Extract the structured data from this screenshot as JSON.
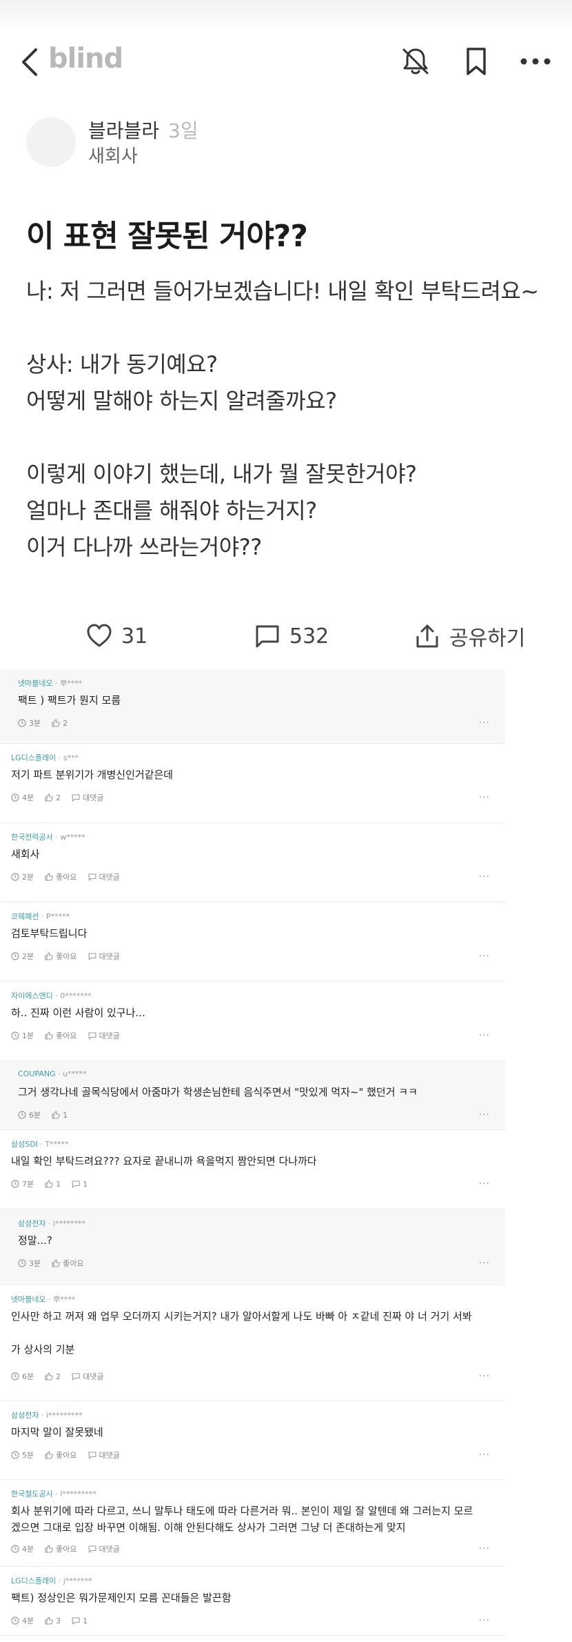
{
  "nav": {
    "logo": "blind",
    "back_icon": "chevron-left-icon",
    "bell_icon": "bell-off-icon",
    "bookmark_icon": "bookmark-icon",
    "more_icon": "more-horizontal-icon"
  },
  "post": {
    "author_name": "블라블라",
    "time": "3일",
    "company": "새회사",
    "title": "이 표현 잘못된 거야??",
    "body": "나: 저 그러면 들어가보겠습니다! 내일 확인 부탁드려요~\n\n상사: 내가 동기예요?\n어떻게 말해야 하는지 알려줄까요?\n\n이렇게 이야기 했는데, 내가 뭘 잘못한거야?\n얼마나 존대를 해줘야 하는거지?\n이거 다나까 쓰라는거야??"
  },
  "actions": {
    "likes": "31",
    "comments": "532",
    "share_label": "공유하기"
  },
  "comments": [
    {
      "company": "넷마블네오",
      "user": "뿌****",
      "text": "팩트 ) 팩트가 뭔지 모름",
      "time": "3분",
      "likes": "2",
      "reply": "",
      "highlight": true
    },
    {
      "company": "LG디스플레이",
      "user": "s***",
      "text": "저기 파트 분위기가 개병신인거같은데",
      "time": "4분",
      "likes": "2",
      "reply": "대댓글",
      "highlight": false
    },
    {
      "company": "한국전력공사",
      "user": "w*****",
      "text": "새회사",
      "time": "2분",
      "likes": "좋아요",
      "reply": "대댓글",
      "highlight": false
    },
    {
      "company": "코웨패션",
      "user": "P*****",
      "text": "검토부탁드립니다",
      "time": "2분",
      "likes": "좋아요",
      "reply": "대댓글",
      "highlight": false
    },
    {
      "company": "자이에스앤디",
      "user": "0*******",
      "text": "하.. 진짜 이런 사람이 있구나...",
      "time": "1분",
      "likes": "좋아요",
      "reply": "대댓글",
      "highlight": false
    },
    {
      "company": "COUPANG",
      "user": "u*****",
      "text": "그거 생각나네 골목식당에서 아줌마가 학생손님한테 음식주면서 \"맛있게 먹자~\" 했던거 ㅋㅋ",
      "time": "6분",
      "likes": "1",
      "reply": "",
      "highlight": true
    },
    {
      "company": "삼성SDI",
      "user": "T*****",
      "text": "내일 확인 부탁드려요??? 요자로 끝내니까 욕을먹지 짬안되면 다나까다",
      "time": "7분",
      "likes": "1",
      "reply": "1",
      "highlight": false
    },
    {
      "company": "삼성전자",
      "user": "i********",
      "text": "정말...?",
      "time": "3분",
      "likes": "좋아요",
      "reply": "",
      "highlight": true
    },
    {
      "company": "넷마블네오",
      "user": "뿌****",
      "text": "인사만 하고 꺼져 왜 업무 오더까지 시키는거지? 내가 알아서할게 나도 바빠 아 ㅈ같네 진짜 야 너 거기 서봐",
      "text2": "가 상사의 기분",
      "time": "6분",
      "likes": "2",
      "reply": "대댓글",
      "highlight": false
    },
    {
      "company": "삼성전자",
      "user": "i*********",
      "text": "마지막 말이 잘못됐네",
      "time": "5분",
      "likes": "좋아요",
      "reply": "대댓글",
      "highlight": false
    },
    {
      "company": "한국철도공사",
      "user": "l*********",
      "text": "회사 분위기에 따라 다르고, 쓰니 말투나 태도에 따라 다른거라 뭐.. 본인이 제일 잘 알텐데 왜 그러는지 모르",
      "text2": "겠으면 그대로 입장 바꾸면 이해됨. 이해 안된다해도 상사가 그러면 그냥 더 존대하는게 맞지",
      "time": "4분",
      "likes": "좋아요",
      "reply": "대댓글",
      "highlight": false
    },
    {
      "company": "LG디스플레이",
      "user": "j*******",
      "text": "팩트) 정상인은 뭐가문제인지 모름 꼰대들은 발끈함",
      "time": "4분",
      "likes": "3",
      "reply": "1",
      "highlight": false
    }
  ]
}
